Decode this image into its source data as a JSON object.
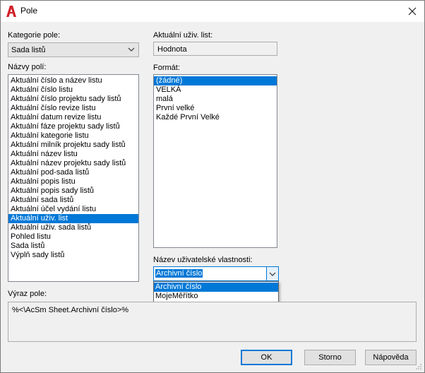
{
  "window": {
    "title": "Pole",
    "app_icon": "autocad-a-icon",
    "accent_color": "#0078d7",
    "brand_color": "#d1202a"
  },
  "left": {
    "category_label": "Kategorie pole:",
    "category_value": "Sada listů",
    "field_names_label": "Názvy polí:",
    "field_names": [
      "Aktuální číslo a název listu",
      "Aktuální číslo listu",
      "Aktuální číslo projektu sady listů",
      "Aktuální číslo revize listu",
      "Aktuální datum revize listu",
      "Aktuální fáze projektu sady listů",
      "Aktuální kategorie listu",
      "Aktuální milník projektu sady listů",
      "Aktuální název listu",
      "Aktuální název projektu sady listů",
      "Aktuální pod-sada listů",
      "Aktuální popis listu",
      "Aktuální popis sady listů",
      "Aktuální sada listů",
      "Aktuální účel vydání listu",
      "Aktuální uživ. list",
      "Aktuální uživ. sada listů",
      "Pohled listu",
      "Sada listů",
      "Výplň sady listů"
    ],
    "selected_field": "Aktuální uživ. list"
  },
  "right": {
    "current_label": "Aktuální uživ. list:",
    "current_value": "Hodnota",
    "format_label": "Formát:",
    "formats": [
      "(žádné)",
      "VELKÁ",
      "malá",
      "První velké",
      "Každé První Velké"
    ],
    "selected_format": "(žádné)",
    "property_label": "Název uživatelské vlastnosti:",
    "property_value": "Archivní číslo",
    "property_options": [
      "Archivní číslo",
      "MojeMěřítko"
    ],
    "property_selected": "Archivní číslo"
  },
  "expression": {
    "label": "Výraz pole:",
    "value": "%<\\AcSm Sheet.Archivní číslo>%"
  },
  "buttons": {
    "ok": "OK",
    "cancel": "Storno",
    "help": "Nápověda"
  }
}
